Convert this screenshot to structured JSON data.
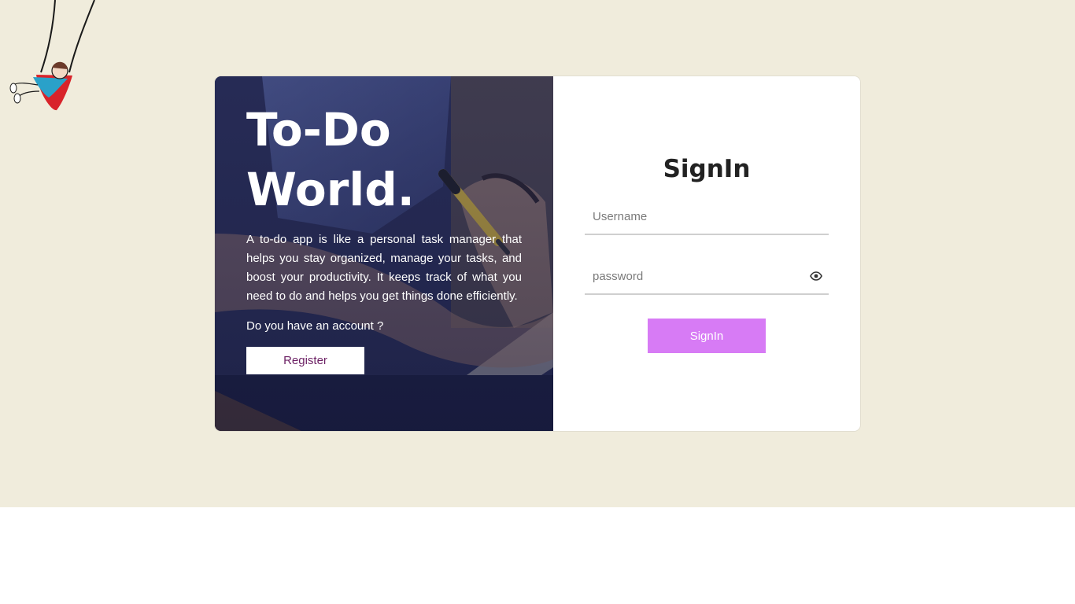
{
  "brand": {
    "title_line1": "To-Do",
    "title_line2": "World.",
    "description": "A to-do app is like a personal task manager that helps you stay organized, manage your tasks, and boost your productivity. It keeps track of what you need to do and helps you get things done efficiently.",
    "account_question": "Do you have an account ?",
    "register_label": "Register"
  },
  "signin": {
    "title": "SignIn",
    "username_placeholder": "Username",
    "password_placeholder": "password",
    "button_label": "SignIn",
    "password_toggle_icon": "eye-icon"
  },
  "colors": {
    "page_background": "#f0ecdc",
    "signin_button": "#d77bf5",
    "register_text": "#6b1f63"
  },
  "decoration": {
    "swing_icon": "swing-illustration-icon",
    "photo_icon": "writing-hand-photo"
  }
}
